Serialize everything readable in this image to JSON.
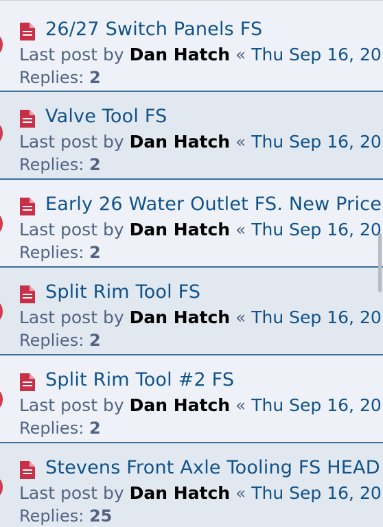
{
  "topics": [
    {
      "title": "26/27 Switch Panels FS",
      "last_post_prefix": "Last post by",
      "author": "Dan Hatch",
      "separator": "«",
      "date": "Thu Sep 16, 20",
      "replies_label": "Replies:",
      "replies": "2"
    },
    {
      "title": "Valve Tool FS",
      "last_post_prefix": "Last post by",
      "author": "Dan Hatch",
      "separator": "«",
      "date": "Thu Sep 16, 20",
      "replies_label": "Replies:",
      "replies": "2"
    },
    {
      "title": "Early 26 Water Outlet FS. New Price",
      "last_post_prefix": "Last post by",
      "author": "Dan Hatch",
      "separator": "«",
      "date": "Thu Sep 16, 20",
      "replies_label": "Replies:",
      "replies": "2"
    },
    {
      "title": "Split Rim Tool FS",
      "last_post_prefix": "Last post by",
      "author": "Dan Hatch",
      "separator": "«",
      "date": "Thu Sep 16, 20",
      "replies_label": "Replies:",
      "replies": "2"
    },
    {
      "title": "Split Rim Tool #2 FS",
      "last_post_prefix": "Last post by",
      "author": "Dan Hatch",
      "separator": "«",
      "date": "Thu Sep 16, 20",
      "replies_label": "Replies:",
      "replies": "2"
    },
    {
      "title": "Stevens Front Axle Tooling FS HEAD",
      "last_post_prefix": "Last post by",
      "author": "Dan Hatch",
      "separator": "«",
      "date": "Thu Sep 16, 20",
      "replies_label": "Replies:",
      "replies": "25"
    }
  ],
  "icons": {
    "topic": "document-icon",
    "status": "unread-status-dot"
  },
  "colors": {
    "link": "#105289",
    "icon": "#c8304a",
    "row_alt_1": "#eef2f8",
    "row_alt_2": "#e1e8f0",
    "divider": "#3e6d97"
  }
}
